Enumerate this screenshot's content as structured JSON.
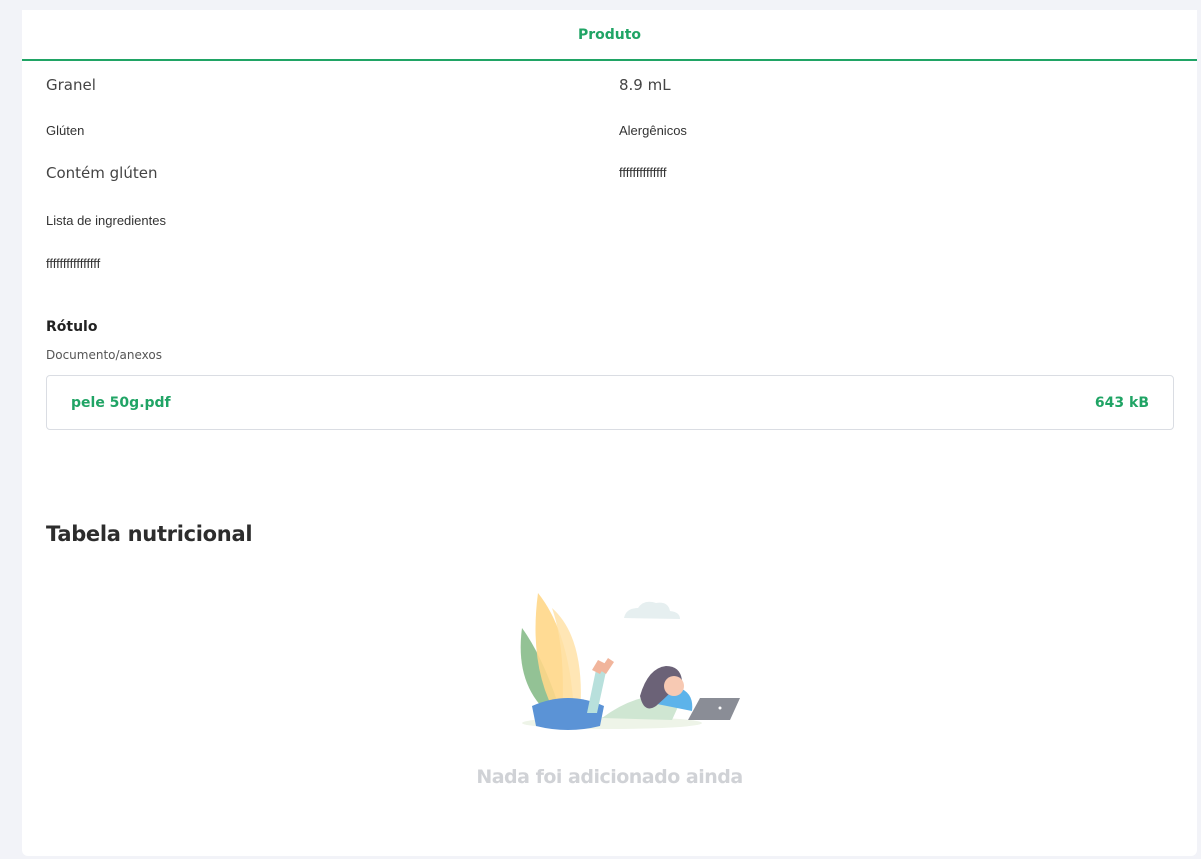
{
  "tab": {
    "title": "Produto"
  },
  "fields": {
    "granel_value": "Granel",
    "volume_value": "8.9 mL",
    "gluten_label": "Glúten",
    "gluten_value": "Contém glúten",
    "alergenicos_label": "Alergênicos",
    "alergenicos_value": "ffffffffffffff",
    "ingredientes_label": "Lista de ingredientes",
    "ingredientes_value": "ffffffffffffffff"
  },
  "rotulo": {
    "title": "Rótulo",
    "subtitle": "Documento/anexos",
    "file": {
      "name": "pele 50g.pdf",
      "size": "643 kB"
    }
  },
  "nutricional": {
    "title": "Tabela nutricional",
    "empty_text": "Nada foi adicionado ainda",
    "illustration_icon": "person-with-laptop-illustration"
  },
  "colors": {
    "accent": "#20a465",
    "background": "#f2f3f8",
    "muted": "#d0d2d6"
  }
}
